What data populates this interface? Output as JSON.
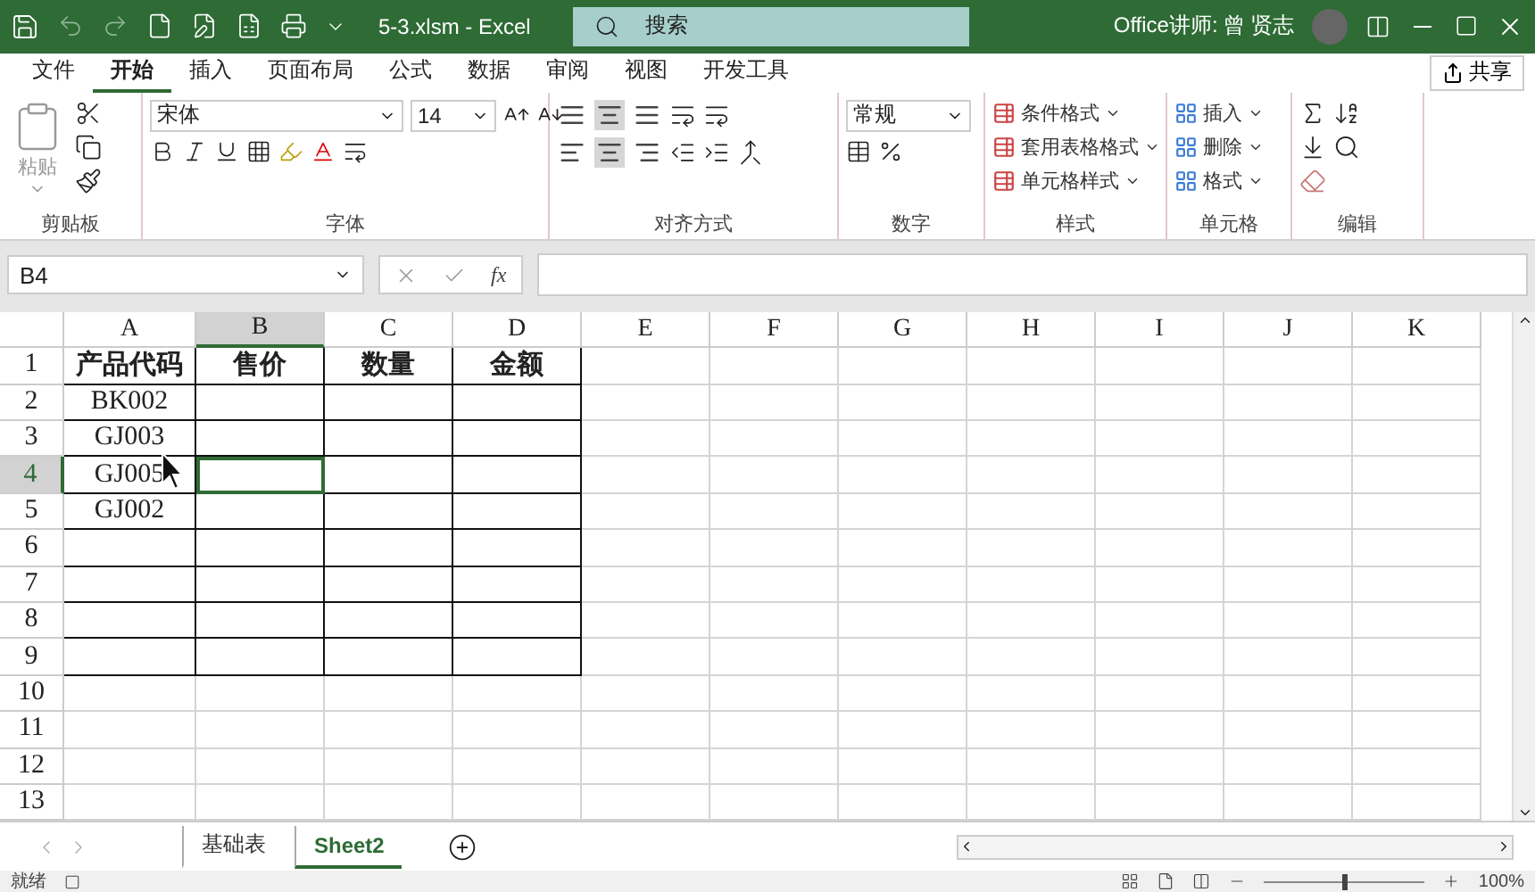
{
  "title_bar": {
    "title": "5-3.xlsm  -  Excel",
    "search_placeholder": "搜索",
    "user": "Office讲师: 曾 贤志"
  },
  "ribbon_tabs": [
    {
      "label": "文件",
      "selected": false
    },
    {
      "label": "开始",
      "selected": true
    },
    {
      "label": "插入",
      "selected": false
    },
    {
      "label": "页面布局",
      "selected": false
    },
    {
      "label": "公式",
      "selected": false
    },
    {
      "label": "数据",
      "selected": false
    },
    {
      "label": "审阅",
      "selected": false
    },
    {
      "label": "视图",
      "selected": false
    },
    {
      "label": "开发工具",
      "selected": false
    }
  ],
  "share": "共享",
  "ribbon": {
    "clipboard": {
      "label": "剪贴板",
      "paste": "粘贴"
    },
    "font": {
      "label": "字体",
      "font_name": "宋体",
      "font_size": "14"
    },
    "alignment": {
      "label": "对齐方式"
    },
    "number": {
      "label": "数字",
      "format": "常规"
    },
    "styles": {
      "label": "样式",
      "items": [
        "条件格式",
        "套用表格格式",
        "单元格样式"
      ]
    },
    "cells": {
      "label": "单元格",
      "items": [
        "插入",
        "删除",
        "格式"
      ]
    },
    "editing": {
      "label": "编辑"
    }
  },
  "formula_bar": {
    "name_box": "B4",
    "fx": "fx"
  },
  "columns": [
    {
      "label": "A",
      "selected": false
    },
    {
      "label": "B",
      "selected": true
    },
    {
      "label": "C",
      "selected": false
    },
    {
      "label": "D",
      "selected": false
    },
    {
      "label": "E",
      "selected": false
    },
    {
      "label": "F",
      "selected": false
    },
    {
      "label": "G",
      "selected": false
    },
    {
      "label": "H",
      "selected": false
    },
    {
      "label": "I",
      "selected": false
    },
    {
      "label": "J",
      "selected": false
    },
    {
      "label": "K",
      "selected": false
    }
  ],
  "rows": [
    {
      "number": "1",
      "kind": "header",
      "bordered": true,
      "selected": false,
      "cells": [
        "产品代码",
        "售价",
        "数量",
        "金额"
      ]
    },
    {
      "number": "2",
      "kind": "data",
      "bordered": true,
      "selected": false,
      "cells": [
        "BK002"
      ]
    },
    {
      "number": "3",
      "kind": "data",
      "bordered": true,
      "selected": false,
      "cells": [
        "GJ003"
      ]
    },
    {
      "number": "4",
      "kind": "data",
      "bordered": true,
      "selected": true,
      "cells": [
        "GJ005"
      ]
    },
    {
      "number": "5",
      "kind": "data",
      "bordered": true,
      "selected": false,
      "cells": [
        "GJ002"
      ]
    },
    {
      "number": "6",
      "kind": "data",
      "bordered": true,
      "selected": false,
      "cells": []
    },
    {
      "number": "7",
      "kind": "data",
      "bordered": true,
      "selected": false,
      "cells": []
    },
    {
      "number": "8",
      "kind": "data",
      "bordered": true,
      "selected": false,
      "cells": []
    },
    {
      "number": "9",
      "kind": "data",
      "bordered": true,
      "selected": false,
      "cells": []
    },
    {
      "number": "10",
      "kind": "data",
      "bordered": false,
      "selected": false,
      "cells": []
    },
    {
      "number": "11",
      "kind": "data",
      "bordered": false,
      "selected": false,
      "cells": []
    },
    {
      "number": "12",
      "kind": "data",
      "bordered": false,
      "selected": false,
      "cells": []
    },
    {
      "number": "13",
      "kind": "data",
      "bordered": false,
      "selected": false,
      "cells": []
    }
  ],
  "sheet_tabs": [
    {
      "label": "基础表",
      "selected": false
    },
    {
      "label": "Sheet2",
      "selected": true
    }
  ],
  "status_bar": {
    "status": "就绪",
    "zoom": {
      "level": 0.5,
      "reading": "100%"
    }
  }
}
